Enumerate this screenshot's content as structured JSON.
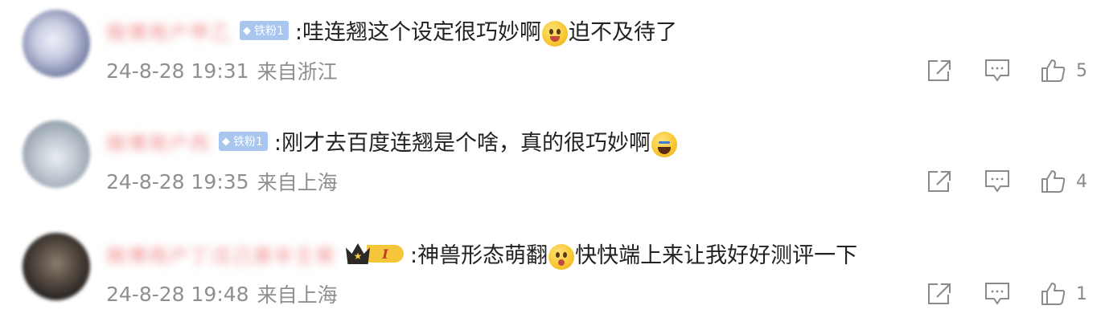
{
  "comments": [
    {
      "username": "微博用户甲乙",
      "badge": {
        "type": "fan",
        "icon": "diamond-icon",
        "label": "铁粉1"
      },
      "text_parts": [
        ":哇连翘这个设定很巧妙啊",
        "迫不及待了"
      ],
      "emoji": "drool-face-emoji",
      "time": "24-8-28 19:31",
      "location": "来自浙江",
      "likes": "5"
    },
    {
      "username": "微博用户丙",
      "badge": {
        "type": "fan",
        "icon": "diamond-icon",
        "label": "铁粉1"
      },
      "text_parts": [
        ":刚才去百度连翘是个啥，真的很巧妙啊",
        ""
      ],
      "emoji": "laugh-cry-emoji",
      "time": "24-8-28 19:35",
      "location": "来自上海",
      "likes": "4"
    },
    {
      "username": "微博用户丁戊己庚辛壬癸",
      "badge": {
        "type": "crown",
        "icon": "crown-icon",
        "label": "I"
      },
      "text_parts": [
        ":神兽形态萌翻",
        "快快端上来让我好好测评一下"
      ],
      "emoji": "cute-face-emoji",
      "time": "24-8-28 19:48",
      "location": "来自上海",
      "likes": "1"
    }
  ],
  "colors": {
    "text": "#222222",
    "meta": "#8f8f8f",
    "fan_badge": "#a9c6ee",
    "crown_level": "#f5c63a"
  }
}
